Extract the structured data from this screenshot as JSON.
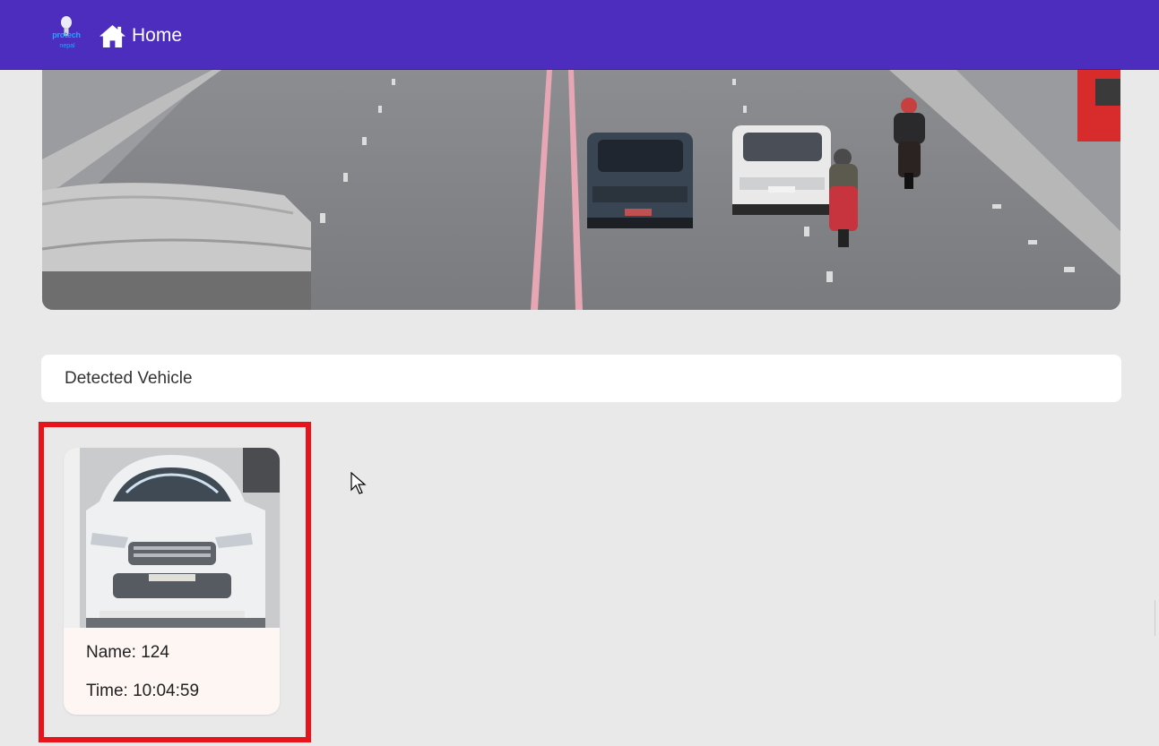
{
  "navbar": {
    "logo_text": "protech",
    "logo_sub": "nepal",
    "home_icon": "home-icon",
    "home_label": "Home",
    "bg_color": "#4c2dbd"
  },
  "banner": {
    "description_icon": "traffic-camera-image"
  },
  "detected_section": {
    "title": "Detected Vehicle"
  },
  "vehicles": [
    {
      "name_label": "Name: 124",
      "time_label": "Time: 10:04:59",
      "highlight_color": "#e8141c"
    }
  ]
}
